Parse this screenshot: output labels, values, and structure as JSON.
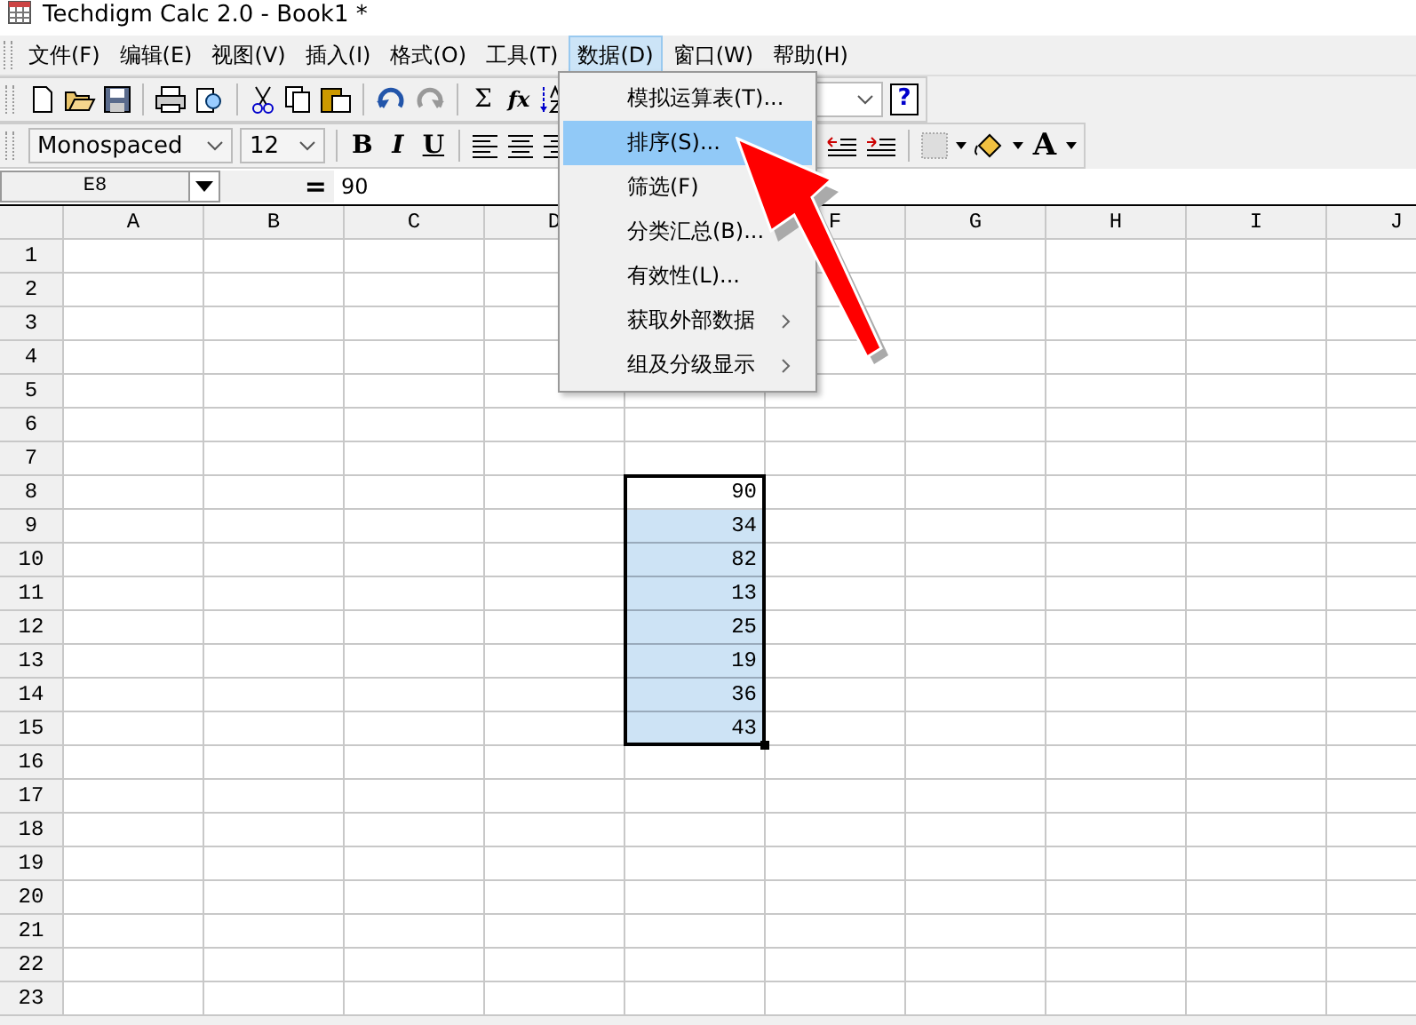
{
  "window": {
    "title": "Techdigm Calc 2.0 - Book1 *"
  },
  "menu_bar": [
    {
      "label": "文件(F)",
      "selected": false
    },
    {
      "label": "编辑(E)",
      "selected": false
    },
    {
      "label": "视图(V)",
      "selected": false
    },
    {
      "label": "插入(I)",
      "selected": false
    },
    {
      "label": "格式(O)",
      "selected": false
    },
    {
      "label": "工具(T)",
      "selected": false
    },
    {
      "label": "数据(D)",
      "selected": true
    },
    {
      "label": "窗口(W)",
      "selected": false
    },
    {
      "label": "帮助(H)",
      "selected": false
    }
  ],
  "dropdown_menu": {
    "items": [
      {
        "label": "模拟运算表(T)...",
        "selected": false,
        "submenu": false
      },
      {
        "label": "排序(S)...",
        "selected": true,
        "submenu": false
      },
      {
        "label": "筛选(F)",
        "selected": false
      },
      {
        "label": "分类汇总(B)...",
        "selected": false,
        "submenu": false
      },
      {
        "label": "有效性(L)...",
        "selected": false,
        "submenu": false
      },
      {
        "label": "获取外部数据",
        "selected": false,
        "submenu": true
      },
      {
        "label": "组及分级显示",
        "selected": false,
        "submenu": true
      }
    ]
  },
  "toolbar": {
    "sum_glyph": "Σ",
    "function_glyph": "fx",
    "help_glyph": "?",
    "bold_glyph": "B",
    "italic_glyph": "I",
    "underline_glyph": "U",
    "font_color_glyph": "A",
    "font": "Monospaced",
    "font_size": "12"
  },
  "formula_bar": {
    "cell_ref": "E8",
    "equals": "=",
    "value": "90"
  },
  "sheet": {
    "columns": [
      "A",
      "B",
      "C",
      "D",
      null,
      "F",
      "G",
      "H",
      "I",
      "J"
    ],
    "rows": [
      {
        "label": "1",
        "cells": []
      },
      {
        "label": "2",
        "cells": []
      },
      {
        "label": "3",
        "cells": []
      },
      {
        "label": "4",
        "cells": []
      },
      {
        "label": "5",
        "cells": []
      },
      {
        "label": "6",
        "cells": []
      },
      {
        "label": "7",
        "cells": []
      },
      {
        "label": "8",
        "cells": [
          null,
          null,
          null,
          null,
          {
            "text": "90",
            "selected": true,
            "active": true
          }
        ]
      },
      {
        "label": "9",
        "cells": [
          null,
          null,
          null,
          null,
          {
            "text": "34",
            "selected": true,
            "active": false
          }
        ]
      },
      {
        "label": "10",
        "cells": [
          null,
          null,
          null,
          null,
          {
            "text": "82",
            "selected": true,
            "active": false
          }
        ]
      },
      {
        "label": "11",
        "cells": [
          null,
          null,
          null,
          null,
          {
            "text": "13",
            "selected": true,
            "active": false
          }
        ]
      },
      {
        "label": "12",
        "cells": [
          null,
          null,
          null,
          null,
          {
            "text": "25",
            "selected": true,
            "active": false
          }
        ]
      },
      {
        "label": "13",
        "cells": [
          null,
          null,
          null,
          null,
          {
            "text": "19",
            "selected": true,
            "active": false
          }
        ]
      },
      {
        "label": "14",
        "cells": [
          null,
          null,
          null,
          null,
          {
            "text": "36",
            "selected": true,
            "active": false
          }
        ]
      },
      {
        "label": "15",
        "cells": [
          null,
          null,
          null,
          null,
          {
            "text": "43",
            "selected": true,
            "active": false
          }
        ]
      },
      {
        "label": "16",
        "cells": []
      },
      {
        "label": "17",
        "cells": []
      },
      {
        "label": "18",
        "cells": []
      },
      {
        "label": "19",
        "cells": []
      },
      {
        "label": "20",
        "cells": []
      },
      {
        "label": "21",
        "cells": []
      },
      {
        "label": "22",
        "cells": []
      },
      {
        "label": "23",
        "cells": []
      }
    ]
  }
}
